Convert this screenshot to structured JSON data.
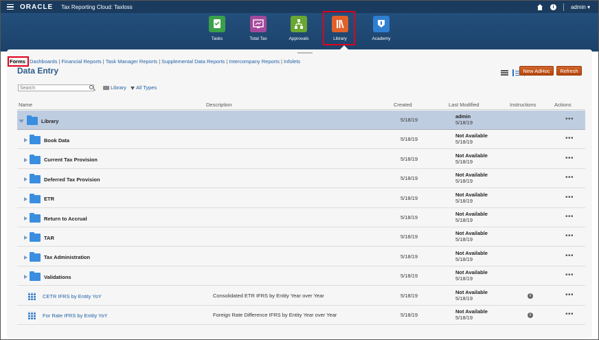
{
  "header": {
    "logo": "ORACLE",
    "app_title": "Tax Reporting Cloud: Taxloss",
    "user_menu": "admin ▾",
    "help_glyph": "i"
  },
  "nav": [
    {
      "label": "Tasks",
      "icon": "tasks-icon",
      "color": "#3aa04a"
    },
    {
      "label": "Total Tax",
      "icon": "total-tax-icon",
      "color": "#a34a9c"
    },
    {
      "label": "Approvals",
      "icon": "approvals-icon",
      "color": "#6aa632"
    },
    {
      "label": "Library",
      "icon": "library-icon",
      "color": "#e2602a",
      "active": true
    },
    {
      "label": "Academy",
      "icon": "academy-icon",
      "color": "#2f7fd0"
    }
  ],
  "tabs": [
    "Forms",
    "Dashboards",
    "Financial Reports",
    "Task Manager Reports",
    "Supplemental Data Reports",
    "Intercompany Reports",
    "Infolets"
  ],
  "page_title": "Data Entry",
  "buttons": {
    "new_adhoc": "New AdHoc",
    "refresh": "Refresh"
  },
  "search": {
    "placeholder": "Search"
  },
  "filters": {
    "library": "Library",
    "types": "All Types"
  },
  "columns": {
    "name": "Name",
    "description": "Description",
    "created": "Created",
    "last_modified": "Last Modified",
    "instructions": "Instructions",
    "actions": "Actions"
  },
  "rows": [
    {
      "name": "Library",
      "type": "folder-root",
      "description": "",
      "created": "5/18/19",
      "mod_by": "admin",
      "mod_date": "5/18/19",
      "info": false,
      "actions": "•••"
    },
    {
      "name": "Book Data",
      "type": "folder",
      "description": "",
      "created": "5/18/19",
      "mod_by": "Not Available",
      "mod_date": "5/18/19",
      "info": false,
      "actions": "•••"
    },
    {
      "name": "Current Tax Provision",
      "type": "folder",
      "description": "",
      "created": "5/18/19",
      "mod_by": "Not Available",
      "mod_date": "5/18/19",
      "info": false,
      "actions": "•••"
    },
    {
      "name": "Deferred Tax Provision",
      "type": "folder",
      "description": "",
      "created": "5/18/19",
      "mod_by": "Not Available",
      "mod_date": "5/18/19",
      "info": false,
      "actions": "•••"
    },
    {
      "name": "ETR",
      "type": "folder",
      "description": "",
      "created": "5/18/19",
      "mod_by": "Not Available",
      "mod_date": "5/18/19",
      "info": false,
      "actions": "•••"
    },
    {
      "name": "Return to Accrual",
      "type": "folder",
      "description": "",
      "created": "5/18/19",
      "mod_by": "Not Available",
      "mod_date": "5/18/19",
      "info": false,
      "actions": "•••"
    },
    {
      "name": "TAR",
      "type": "folder",
      "description": "",
      "created": "5/18/19",
      "mod_by": "Not Available",
      "mod_date": "5/18/19",
      "info": false,
      "actions": "•••"
    },
    {
      "name": "Tax Administration",
      "type": "folder",
      "description": "",
      "created": "5/18/19",
      "mod_by": "Not Available",
      "mod_date": "5/18/19",
      "info": false,
      "actions": "•••"
    },
    {
      "name": "Validations",
      "type": "folder",
      "description": "",
      "created": "5/18/19",
      "mod_by": "Not Available",
      "mod_date": "5/18/19",
      "info": false,
      "actions": "•••"
    },
    {
      "name": "CETR IFRS by Entity YoY",
      "type": "form",
      "description": "Consolidated ETR IFRS by Entity Year over Year",
      "created": "5/18/19",
      "mod_by": "Not Available",
      "mod_date": "5/18/19",
      "info": true,
      "actions": "•••"
    },
    {
      "name": "For Rate IFRS by Entity YoY",
      "type": "form",
      "description": "Foreign Rate Difference IFRS by Entity Year over Year",
      "created": "5/18/19",
      "mod_by": "Not Available",
      "mod_date": "5/18/19",
      "info": true,
      "actions": "•••"
    }
  ]
}
